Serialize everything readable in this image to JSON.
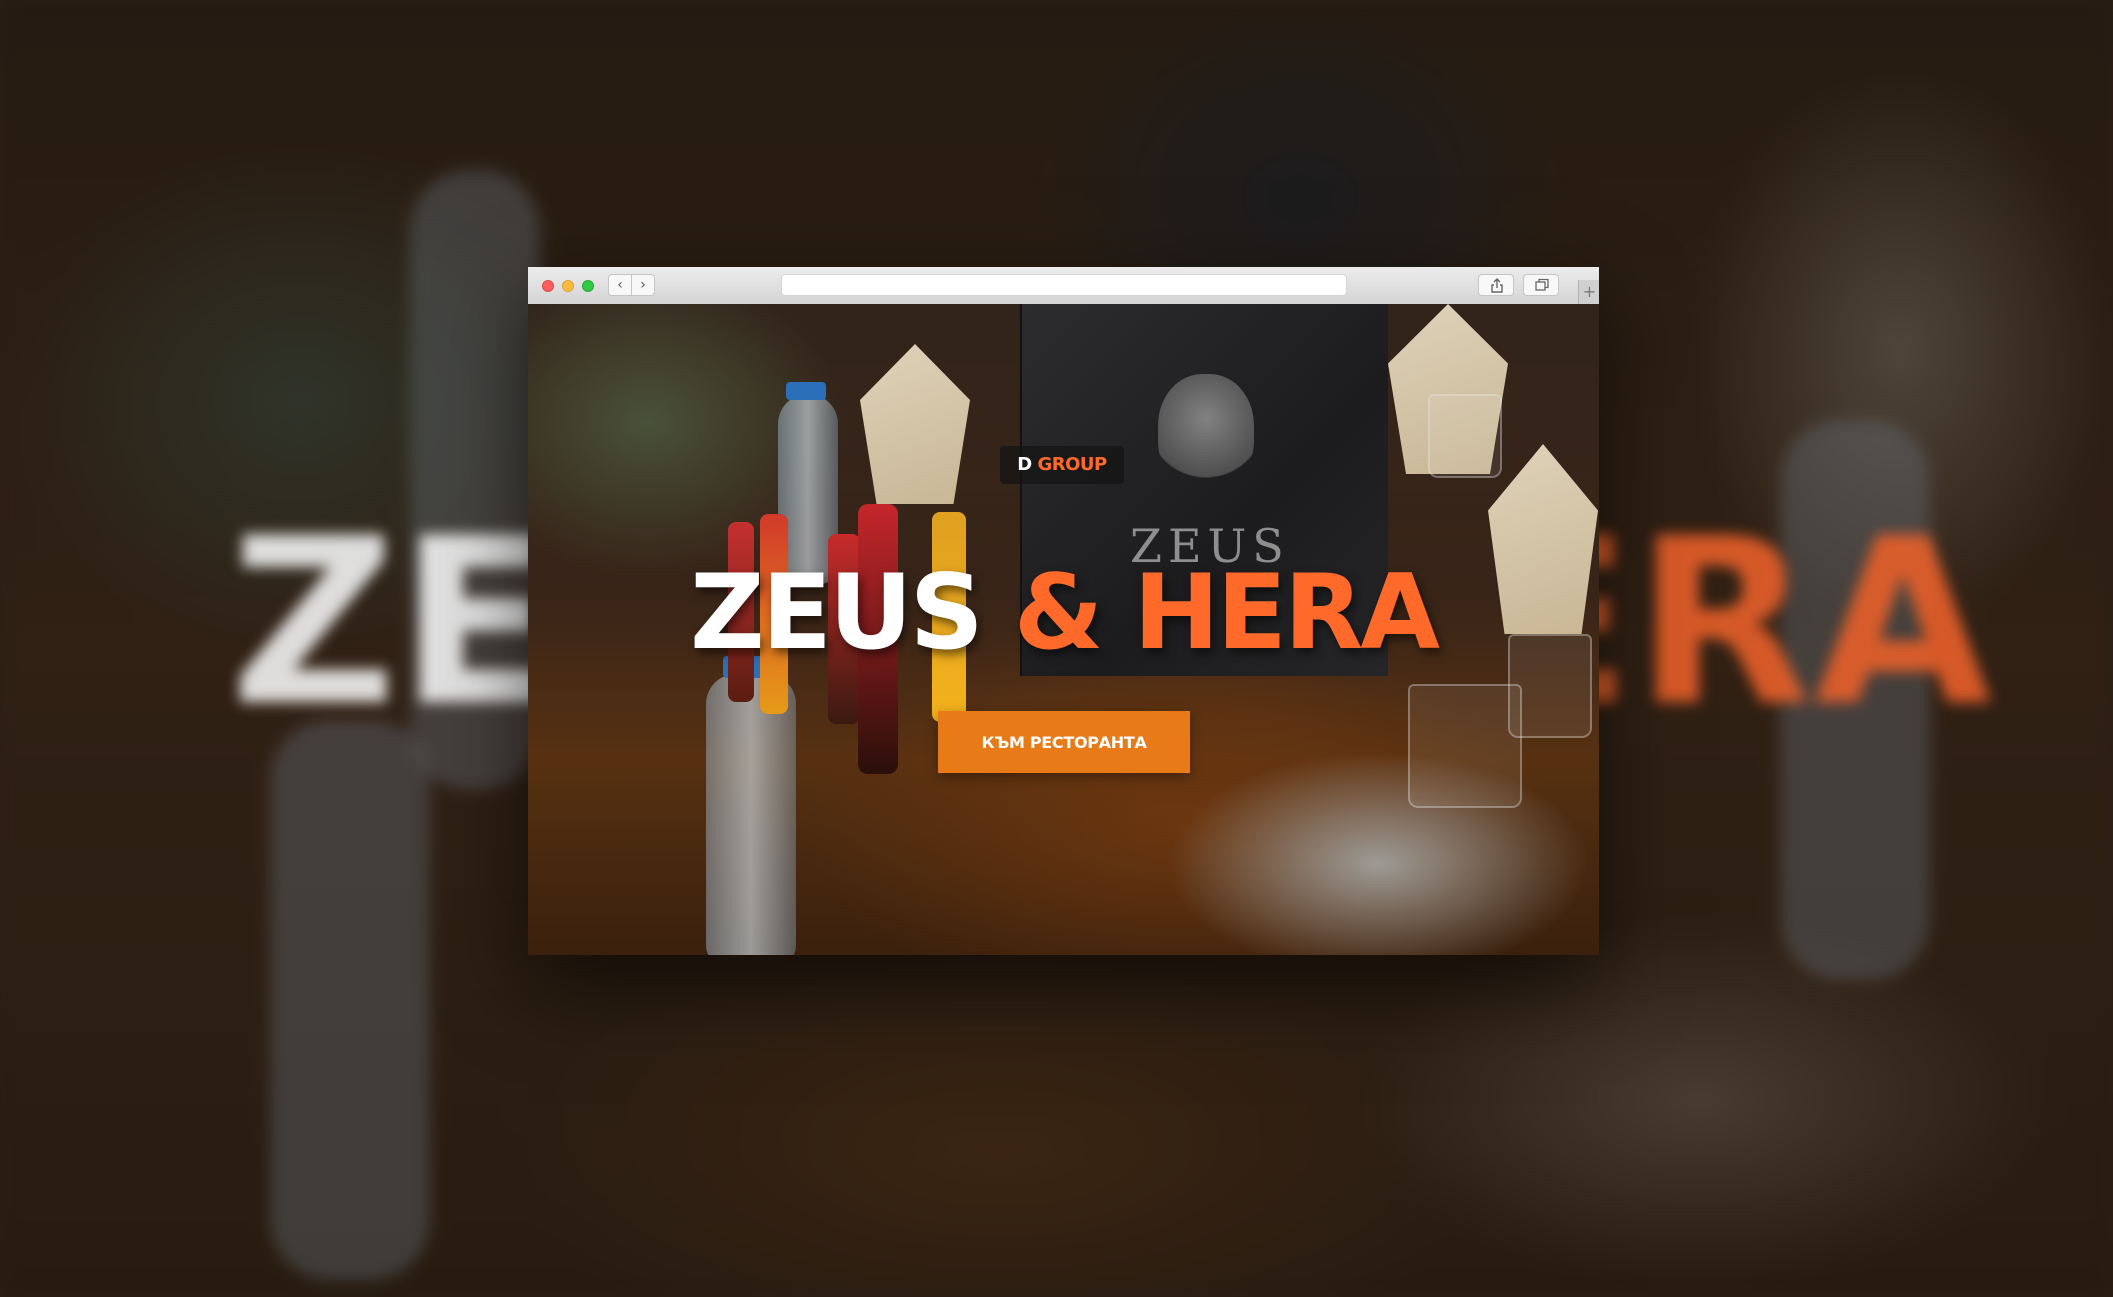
{
  "browser": {
    "nav_back": "‹",
    "nav_forward": "›",
    "url": "",
    "new_tab": "+"
  },
  "hero": {
    "menu_word": "ZEUS",
    "badge": {
      "d": "D",
      "group": "GROUP"
    },
    "title": {
      "white": "ZEUS",
      "orange": "& HERA"
    },
    "cta_label": "КЪМ РЕСТОРАНТА"
  },
  "backdrop_title": {
    "white": "ZEUS",
    "orange": "& HERA"
  },
  "colors": {
    "accent": "#ff6a2a",
    "cta": "#e87a18",
    "title_white": "#ffffff"
  },
  "icons": [
    "close-dot-icon",
    "minimize-dot-icon",
    "zoom-dot-icon",
    "chevron-left-icon",
    "chevron-right-icon",
    "share-icon",
    "tabs-icon",
    "plus-icon"
  ]
}
